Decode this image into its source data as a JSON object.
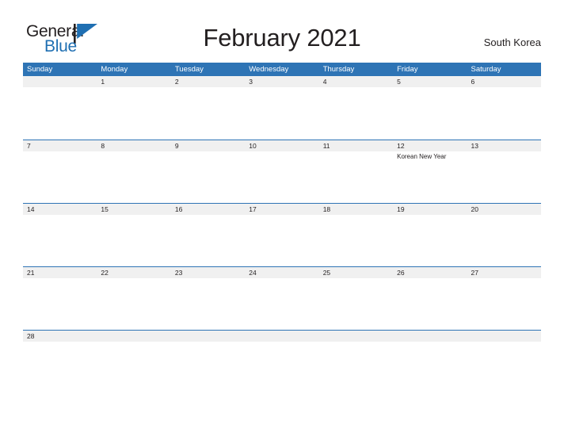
{
  "logo": {
    "text_primary": "General",
    "text_secondary": "Blue",
    "flag_icon": "blue-triangle-flag-icon",
    "primary_color": "#231f20",
    "secondary_color": "#1f6fb2"
  },
  "header": {
    "title": "February 2021",
    "country": "South Korea"
  },
  "theme": {
    "header_blue": "#2e74b5",
    "day_band_gray": "#f0f0f0",
    "text_dark": "#231f20",
    "page_background": "#ffffff"
  },
  "calendar": {
    "month": "February",
    "year": "2021",
    "weekdays": [
      "Sunday",
      "Monday",
      "Tuesday",
      "Wednesday",
      "Thursday",
      "Friday",
      "Saturday"
    ],
    "weeks": [
      {
        "days": [
          {
            "num": "",
            "event": ""
          },
          {
            "num": "1",
            "event": ""
          },
          {
            "num": "2",
            "event": ""
          },
          {
            "num": "3",
            "event": ""
          },
          {
            "num": "4",
            "event": ""
          },
          {
            "num": "5",
            "event": ""
          },
          {
            "num": "6",
            "event": ""
          }
        ]
      },
      {
        "days": [
          {
            "num": "7",
            "event": ""
          },
          {
            "num": "8",
            "event": ""
          },
          {
            "num": "9",
            "event": ""
          },
          {
            "num": "10",
            "event": ""
          },
          {
            "num": "11",
            "event": ""
          },
          {
            "num": "12",
            "event": "Korean New Year"
          },
          {
            "num": "13",
            "event": ""
          }
        ]
      },
      {
        "days": [
          {
            "num": "14",
            "event": ""
          },
          {
            "num": "15",
            "event": ""
          },
          {
            "num": "16",
            "event": ""
          },
          {
            "num": "17",
            "event": ""
          },
          {
            "num": "18",
            "event": ""
          },
          {
            "num": "19",
            "event": ""
          },
          {
            "num": "20",
            "event": ""
          }
        ]
      },
      {
        "days": [
          {
            "num": "21",
            "event": ""
          },
          {
            "num": "22",
            "event": ""
          },
          {
            "num": "23",
            "event": ""
          },
          {
            "num": "24",
            "event": ""
          },
          {
            "num": "25",
            "event": ""
          },
          {
            "num": "26",
            "event": ""
          },
          {
            "num": "27",
            "event": ""
          }
        ]
      },
      {
        "days": [
          {
            "num": "28",
            "event": ""
          },
          {
            "num": "",
            "event": ""
          },
          {
            "num": "",
            "event": ""
          },
          {
            "num": "",
            "event": ""
          },
          {
            "num": "",
            "event": ""
          },
          {
            "num": "",
            "event": ""
          },
          {
            "num": "",
            "event": ""
          }
        ]
      }
    ]
  }
}
